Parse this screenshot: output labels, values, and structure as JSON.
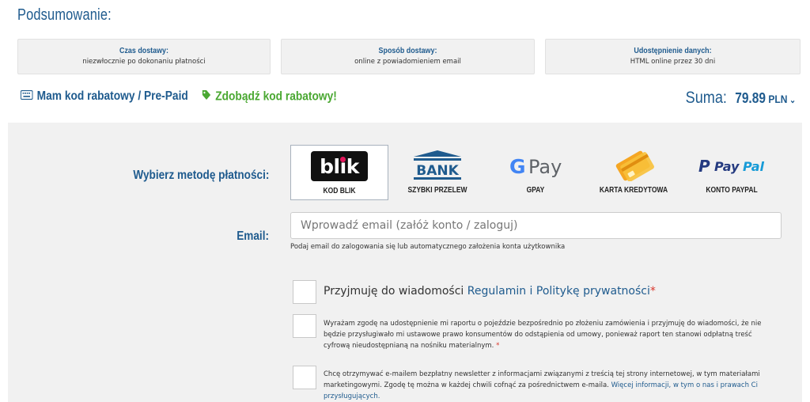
{
  "summary": {
    "title": "Podsumowanie:",
    "boxes": [
      {
        "label": "Czas dostawy:",
        "value": "niezwłocznie po dokonaniu płatności"
      },
      {
        "label": "Sposób dostawy:",
        "value": "online z powiadomieniem email"
      },
      {
        "label": "Udostępnienie danych:",
        "value": "HTML online przez 30 dni"
      }
    ]
  },
  "promo": {
    "have_code": "Mam kod rabatowy / Pre-Paid",
    "get_code": "Zdobądź kod rabatowy!",
    "icons": {
      "have_code": "keyboard-icon",
      "get_code": "tag-icon"
    }
  },
  "total": {
    "label": "Suma:",
    "amount": "79.89",
    "currency": "PLN"
  },
  "payment": {
    "label": "Wybierz metodę płatności:",
    "selected": "KOD BLIK",
    "methods": [
      {
        "name": "KOD BLIK",
        "logo": "blik"
      },
      {
        "name": "SZYBKI PRZELEW",
        "logo": "BANK"
      },
      {
        "name": "GPAY",
        "logo": "G Pay"
      },
      {
        "name": "KARTA KREDYTOWA",
        "logo": "credit-cards-icon"
      },
      {
        "name": "KONTO PAYPAL",
        "logo": "PayPal"
      }
    ]
  },
  "email": {
    "label": "Email:",
    "placeholder": "Wprowadź email (załóż konto / zaloguj)",
    "hint": "Podaj email do zalogowania się lub automatycznego założenia konta użytkownika"
  },
  "consents": {
    "terms_prefix": "Przyjmuję do wiadomości ",
    "terms_link": "Regulamin i Politykę prywatności",
    "terms_req": "*",
    "report": "Wyrażam zgodę na udostępnienie mi raportu o pojeździe bezpośrednio po złożeniu zamówienia i przyjmuję do wiadomości, że nie będzie przysługiwało mi ustawowe prawo konsumentów do odstąpienia od umowy, ponieważ raport ten stanowi odpłatną treść cyfrową nieudostępnianą na nośniku materialnym.",
    "report_req": "*",
    "newsletter": "Chcę otrzymywać e-mailem bezpłatny newsletter z informacjami związanymi z treścią tej strony internetowej, w tym materiałami marketingowymi. Zgodę tę można w każdej chwili cofnąć za pośrednictwem e-maila. ",
    "newsletter_link": "Więcej informacji, w tym o nas i prawach Ci przysługujących."
  },
  "colors": {
    "accent": "#1f5b8e",
    "green": "#4aa832",
    "panel": "#f1f1f1",
    "required": "#d9362b"
  }
}
